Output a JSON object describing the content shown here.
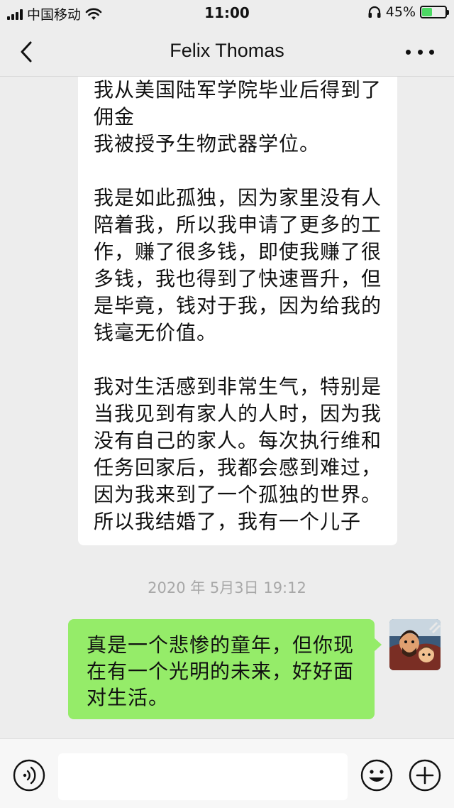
{
  "status": {
    "carrier": "中国移动",
    "time": "11:00",
    "battery_text": "45%",
    "battery_level": 0.45
  },
  "nav": {
    "title": "Felix Thomas"
  },
  "messages": {
    "incoming": {
      "paragraphs": [
        "我从美国陆军学院毕业后得到了佣金\n我被授予生物武器学位。",
        "我是如此孤独，因为家里没有人陪着我，所以我申请了更多的工作，赚了很多钱，即使我赚了很多钱，我也得到了快速晋升，但是毕竟，钱对于我，因为给我的钱毫无价值。",
        "我对生活感到非常生气，特别是当我见到有家人的人时，因为我没有自己的家人。每次执行维和任务回家后，我都会感到难过，因为我来到了一个孤独的世界。所以我结婚了，我有一个儿子"
      ]
    },
    "timestamp": "2020 年 5月3日 19:12",
    "outgoing": {
      "text": "真是一个悲惨的童年，但你现在有一个光明的未来，好好面对生活。"
    }
  },
  "input": {
    "value": ""
  },
  "icons": {
    "back": "chevron-left-icon",
    "more": "more-dots-icon",
    "voice": "voice-icon",
    "emoji": "emoji-icon",
    "plus": "plus-icon"
  },
  "colors": {
    "background": "#ededed",
    "outgoing_bubble": "#95ec69",
    "incoming_bubble": "#ffffff",
    "battery_fill": "#4cd964",
    "timestamp": "#a8a8a8"
  }
}
